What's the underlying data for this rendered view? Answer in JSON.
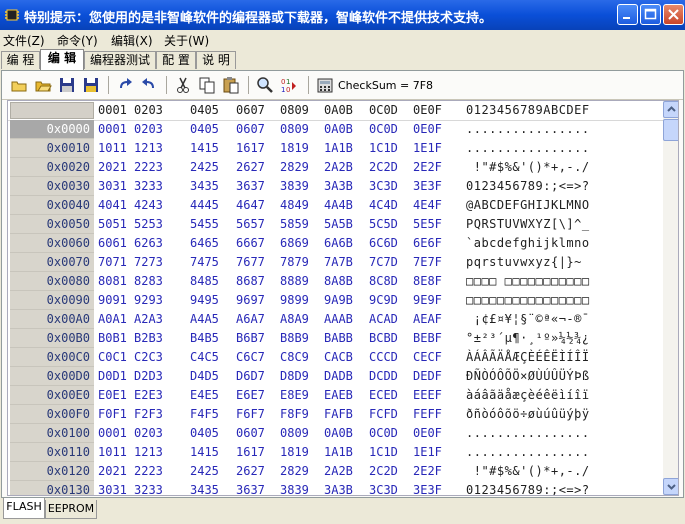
{
  "window": {
    "title": "特别提示：您使用的是非智峰软件的编程器或下载器，智峰软件不提供技术支持。",
    "min_icon": "minimize-icon",
    "max_icon": "maximize-icon",
    "close_icon": "close-icon"
  },
  "menu": [
    "文件(Z)",
    "命令(Y)",
    "编辑(X)",
    "关于(W)"
  ],
  "tabs": [
    "编 程",
    "编 辑",
    "编程器测试",
    "配 置",
    "说 明"
  ],
  "active_tab": 1,
  "toolbar": {
    "checksum": "CheckSum = 7F8"
  },
  "hex_header": {
    "cols": [
      "0001",
      "0203",
      "0405",
      "0607",
      "0809",
      "0A0B",
      "0C0D",
      "0E0F"
    ],
    "ascii": "0123456789ABCDEF"
  },
  "rows": [
    {
      "addr": "0x0000",
      "hex": [
        "0001",
        "0203",
        "0405",
        "0607",
        "0809",
        "0A0B",
        "0C0D",
        "0E0F"
      ],
      "ascii": "................"
    },
    {
      "addr": "0x0010",
      "hex": [
        "1011",
        "1213",
        "1415",
        "1617",
        "1819",
        "1A1B",
        "1C1D",
        "1E1F"
      ],
      "ascii": "................"
    },
    {
      "addr": "0x0020",
      "hex": [
        "2021",
        "2223",
        "2425",
        "2627",
        "2829",
        "2A2B",
        "2C2D",
        "2E2F"
      ],
      "ascii": " !\"#$%&'()*+,-./"
    },
    {
      "addr": "0x0030",
      "hex": [
        "3031",
        "3233",
        "3435",
        "3637",
        "3839",
        "3A3B",
        "3C3D",
        "3E3F"
      ],
      "ascii": "0123456789:;<=>?"
    },
    {
      "addr": "0x0040",
      "hex": [
        "4041",
        "4243",
        "4445",
        "4647",
        "4849",
        "4A4B",
        "4C4D",
        "4E4F"
      ],
      "ascii": "@ABCDEFGHIJKLMNO"
    },
    {
      "addr": "0x0050",
      "hex": [
        "5051",
        "5253",
        "5455",
        "5657",
        "5859",
        "5A5B",
        "5C5D",
        "5E5F"
      ],
      "ascii": "PQRSTUVWXYZ[\\]^_"
    },
    {
      "addr": "0x0060",
      "hex": [
        "6061",
        "6263",
        "6465",
        "6667",
        "6869",
        "6A6B",
        "6C6D",
        "6E6F"
      ],
      "ascii": "`abcdefghijklmno"
    },
    {
      "addr": "0x0070",
      "hex": [
        "7071",
        "7273",
        "7475",
        "7677",
        "7879",
        "7A7B",
        "7C7D",
        "7E7F"
      ],
      "ascii": "pqrstuvwxyz{|}~"
    },
    {
      "addr": "0x0080",
      "hex": [
        "8081",
        "8283",
        "8485",
        "8687",
        "8889",
        "8A8B",
        "8C8D",
        "8E8F"
      ],
      "ascii": "□□□□ □□□□□□□□□□□"
    },
    {
      "addr": "0x0090",
      "hex": [
        "9091",
        "9293",
        "9495",
        "9697",
        "9899",
        "9A9B",
        "9C9D",
        "9E9F"
      ],
      "ascii": "□□□□□□□□□□□□□□□□"
    },
    {
      "addr": "0x00A0",
      "hex": [
        "A0A1",
        "A2A3",
        "A4A5",
        "A6A7",
        "A8A9",
        "AAAB",
        "ACAD",
        "AEAF"
      ],
      "ascii": " ¡¢£¤¥¦§¨©ª«¬-®¯"
    },
    {
      "addr": "0x00B0",
      "hex": [
        "B0B1",
        "B2B3",
        "B4B5",
        "B6B7",
        "B8B9",
        "BABB",
        "BCBD",
        "BEBF"
      ],
      "ascii": "°±²³´µ¶·¸¹º»¼½¾¿"
    },
    {
      "addr": "0x00C0",
      "hex": [
        "C0C1",
        "C2C3",
        "C4C5",
        "C6C7",
        "C8C9",
        "CACB",
        "CCCD",
        "CECF"
      ],
      "ascii": "ÀÁÂÃÄÅÆÇÈÉÊËÌÍÎÏ"
    },
    {
      "addr": "0x00D0",
      "hex": [
        "D0D1",
        "D2D3",
        "D4D5",
        "D6D7",
        "D8D9",
        "DADB",
        "DCDD",
        "DEDF"
      ],
      "ascii": "ÐÑÒÓÔÕÖ×ØÙÚÛÜÝÞß"
    },
    {
      "addr": "0x00E0",
      "hex": [
        "E0E1",
        "E2E3",
        "E4E5",
        "E6E7",
        "E8E9",
        "EAEB",
        "ECED",
        "EEEF"
      ],
      "ascii": "àáâãäåæçèéêëìíîï"
    },
    {
      "addr": "0x00F0",
      "hex": [
        "F0F1",
        "F2F3",
        "F4F5",
        "F6F7",
        "F8F9",
        "FAFB",
        "FCFD",
        "FEFF"
      ],
      "ascii": "ðñòóôõö÷øùúûüýþÿ"
    },
    {
      "addr": "0x0100",
      "hex": [
        "0001",
        "0203",
        "0405",
        "0607",
        "0809",
        "0A0B",
        "0C0D",
        "0E0F"
      ],
      "ascii": "................"
    },
    {
      "addr": "0x0110",
      "hex": [
        "1011",
        "1213",
        "1415",
        "1617",
        "1819",
        "1A1B",
        "1C1D",
        "1E1F"
      ],
      "ascii": "................"
    },
    {
      "addr": "0x0120",
      "hex": [
        "2021",
        "2223",
        "2425",
        "2627",
        "2829",
        "2A2B",
        "2C2D",
        "2E2F"
      ],
      "ascii": " !\"#$%&'()*+,-./"
    },
    {
      "addr": "0x0130",
      "hex": [
        "3031",
        "3233",
        "3435",
        "3637",
        "3839",
        "3A3B",
        "3C3D",
        "3E3F"
      ],
      "ascii": "0123456789:;<=>?"
    }
  ],
  "bottom_tabs": [
    "FLASH",
    "EEPROM"
  ],
  "colors": {
    "title_bar": "#0a4fd8",
    "hex_text": "#2828b8",
    "addr_bg": "#d8d5cc"
  }
}
